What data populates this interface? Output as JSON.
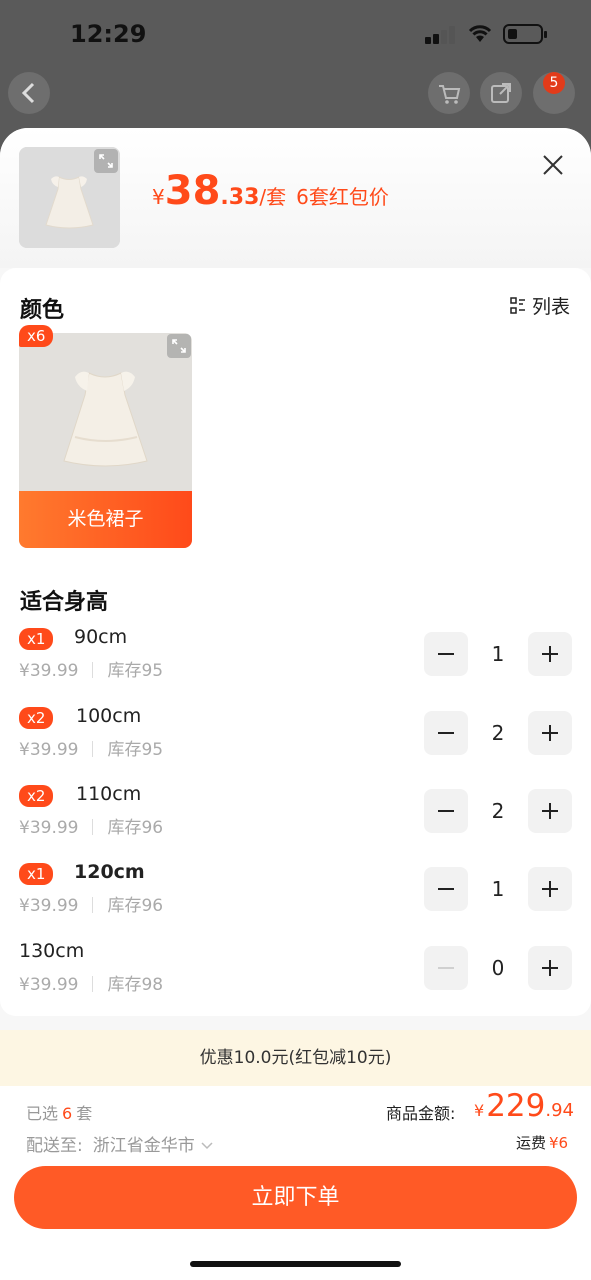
{
  "status_bar": {
    "time": "12:29"
  },
  "background": {
    "cart_badge": "5"
  },
  "header": {
    "currency": "¥",
    "price_int": "38",
    "price_dec": ".33",
    "price_unit": "/套",
    "price_tag": "6套红包价"
  },
  "color_section": {
    "title": "颜色",
    "list_toggle_label": "列表",
    "options": [
      {
        "label": "米色裙子",
        "badge": "x6"
      }
    ]
  },
  "size_section": {
    "title": "适合身高",
    "rows": [
      {
        "badge": "x1",
        "name": "90cm",
        "price": "¥39.99",
        "stock": "库存95",
        "qty": "1",
        "bold": false,
        "minus_disabled": false
      },
      {
        "badge": "x2",
        "name": "100cm",
        "price": "¥39.99",
        "stock": "库存95",
        "qty": "2",
        "bold": false,
        "minus_disabled": false
      },
      {
        "badge": "x2",
        "name": "110cm",
        "price": "¥39.99",
        "stock": "库存96",
        "qty": "2",
        "bold": false,
        "minus_disabled": false
      },
      {
        "badge": "x1",
        "name": "120cm",
        "price": "¥39.99",
        "stock": "库存96",
        "qty": "1",
        "bold": true,
        "minus_disabled": false
      },
      {
        "badge": "",
        "name": "130cm",
        "price": "¥39.99",
        "stock": "库存98",
        "qty": "0",
        "bold": false,
        "minus_disabled": true
      }
    ]
  },
  "promo": {
    "text": "优惠10.0元(红包减10元)"
  },
  "footer": {
    "selected_prefix": "已选",
    "selected_count": "6",
    "selected_suffix": "套",
    "total_label": "商品金额:",
    "total_currency": "¥",
    "total_int": "229",
    "total_dec": ".94",
    "ship_to_label": "配送至:",
    "ship_to_address": "浙江省金华市",
    "freight_label": "运费",
    "freight_value": "¥6",
    "order_button": "立即下单"
  },
  "colors": {
    "accent": "#ff4a1a",
    "button": "#ff5a26",
    "promo_bg": "#fdf6e3"
  }
}
